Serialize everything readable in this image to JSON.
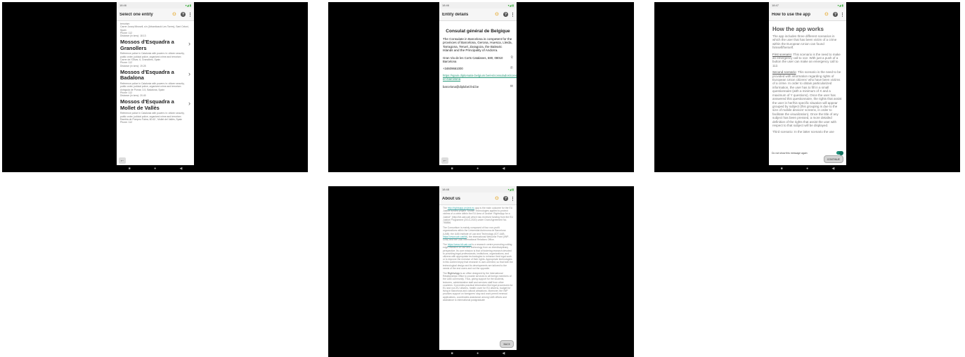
{
  "panel1": {
    "status": {
      "time": "18:46",
      "right": "▾◢ ▮"
    },
    "title": "Select one entity",
    "top_lines": [
      "terrorism",
      "Carrer Josep Mirosell, s/n (Urbanització Les Torres), Sant Celoni, Spain",
      "Phone: 112",
      "Distance (in kms): 18.13"
    ],
    "entities": [
      {
        "name": "Mossos d'Esquadra a Granollers",
        "desc": "Reference police in Catalonia with powers in: citizen security, public order, judicial police, organized crime and terrorism",
        "address": "Carrer de l'Olivar, 6, Granollers, Spain",
        "phone": "Phone: 112",
        "distance": "Distance (in kms): 19.28"
      },
      {
        "name": "Mossos d'Esquadra a Badalona",
        "desc": "Reference police in Catalonia with powers in: citizen security, public order, judicial police, organized crime and terrorism",
        "address": "Avinguda de Pomar, 3-5, Badalona, Spain",
        "phone": "Phone: 112",
        "distance": "Distance (in kms): 20.45"
      },
      {
        "name": "Mossos d'Esquadra a Mollet de Vallès",
        "desc": "Reference police in Catalonia with powers in: citizen security, public order, judicial police, organized crime and terrorism",
        "address": "Rambla de Pompeu Fabra, 60-62 , Mollet del Vallès, Spain",
        "phone": "Phone: 112",
        "distance": ""
      }
    ]
  },
  "panel2": {
    "status": {
      "time": "18:46",
      "right": "▾◢ ▮"
    },
    "title": "Entity details",
    "entity_name": "Consulat général de Belgique",
    "description": "The Consulate in Barcelona is competent for the provinces of Barcelona, Gerona, Huesca, Lleida, Tarragona, Teruel, Zaragoza, the Balearic Islands and the Principality of Andorra.",
    "address": "Gran Via de les Corts Catalanes, 680, 08010 Barcelona",
    "phone": "+34609661000",
    "url": "https://spain.diplomatie.belgium.be/es/consulados/consulado-en-barcelona",
    "email": "barcelona@diplobel.fed.be"
  },
  "panel3": {
    "status": {
      "time": "18:47",
      "right": "▾◢ ▮"
    },
    "title": "How to use the app",
    "heading": "How the app works",
    "intro": "The app includes three different scenarios in which the user that has been victim of a crime within the European Union can found himself/herself.",
    "first_label": "First scenario",
    "first_text": ": This scenario is the need to make an emergency call to 112. With just a push of a button the user can make an emergency call to 112.",
    "second_label": "Second scenario",
    "second_text": ": This scenario is the need to be provided with information regarding rights of European Union citizens' who have been victims of a crime. In order to obtain particularized information, the user has to fill in a small questionnaire (with a minimum of X and a maximum of Y questions). Once the user has answered this questionnaire, the rights that assist the user in her/his specific situation will appear grouped by subject (this grouping is due to the size of mobile devices' screens, in order to facilitate the visualization). Once the title of any subject has been pressed, a more detailed definition of the rights that assist the user with respect to that subject will be displayed.",
    "third_text": "Third scenario: In the latter scenario the use",
    "checkbox_label": "Do not show this message again",
    "continue_label": "CONTINUE"
  },
  "panel4": {
    "status": {
      "time": "18:48",
      "right": "▾◢ ▮"
    },
    "title": "About us",
    "paragraphs": [
      {
        "before": "The ",
        "link": "http://rightsapp.project.eu",
        "after": " app is the main outcome for the EU Justice funded project \"Mobile Technologies applied to protect victims of a crime within the EU Area of Justice: RightsApp for a Justice\" (http://idt.uab.cat) which has received funding from the EU Justice Programme (2014-2020) under Grant Agreement No. 785856."
      },
      {
        "before": "The Consortium is mainly composed of four non-profit organizations within the Universitat Autònoma de Barcelona (UAB): the UAB Institute of Law and Technology (IDT-UAB, ",
        "link": "https://www.uab.cat/idt",
        "after": "), the International Welcome Point (IWP-UAB) and the UAB International Relations Office."
      },
      {
        "before": "The ",
        "link": "https://www.idt.uab.cat",
        "after": " is a research centre promoting cutting edge research on law and technology from an interdisciplinary perspective. Its core mission is that of fostering research devoted to providing legal professionals, institutions, organizations, and citizens with appropriate technologies to enhance their legal work or to improve the exercise of their rights. Appropriate technologies in this context imply that research is user-oriented, so that both the technological design and its developments are tailored to the needs of the end users and not the opposite."
      },
      {
        "before": "The ",
        "link": "RightsApp",
        "after": " is an office designed by the International Relationships Office to provide services to all foreign members of the UAB community. Thus, giving support for the students, lecturers, administrative staff and services staff from other countries. It provides practical information like legal procedures for EU and non-EU citizens, health cover for EU citizens, budget for living in Barcelona and cultural attractions. Moreover, the IWP provides support on foreigners' stay and work permit renewal applications, coordinates assistance among UAB offices and assistance to international postgraduate"
      }
    ],
    "back_label": "BACK"
  }
}
